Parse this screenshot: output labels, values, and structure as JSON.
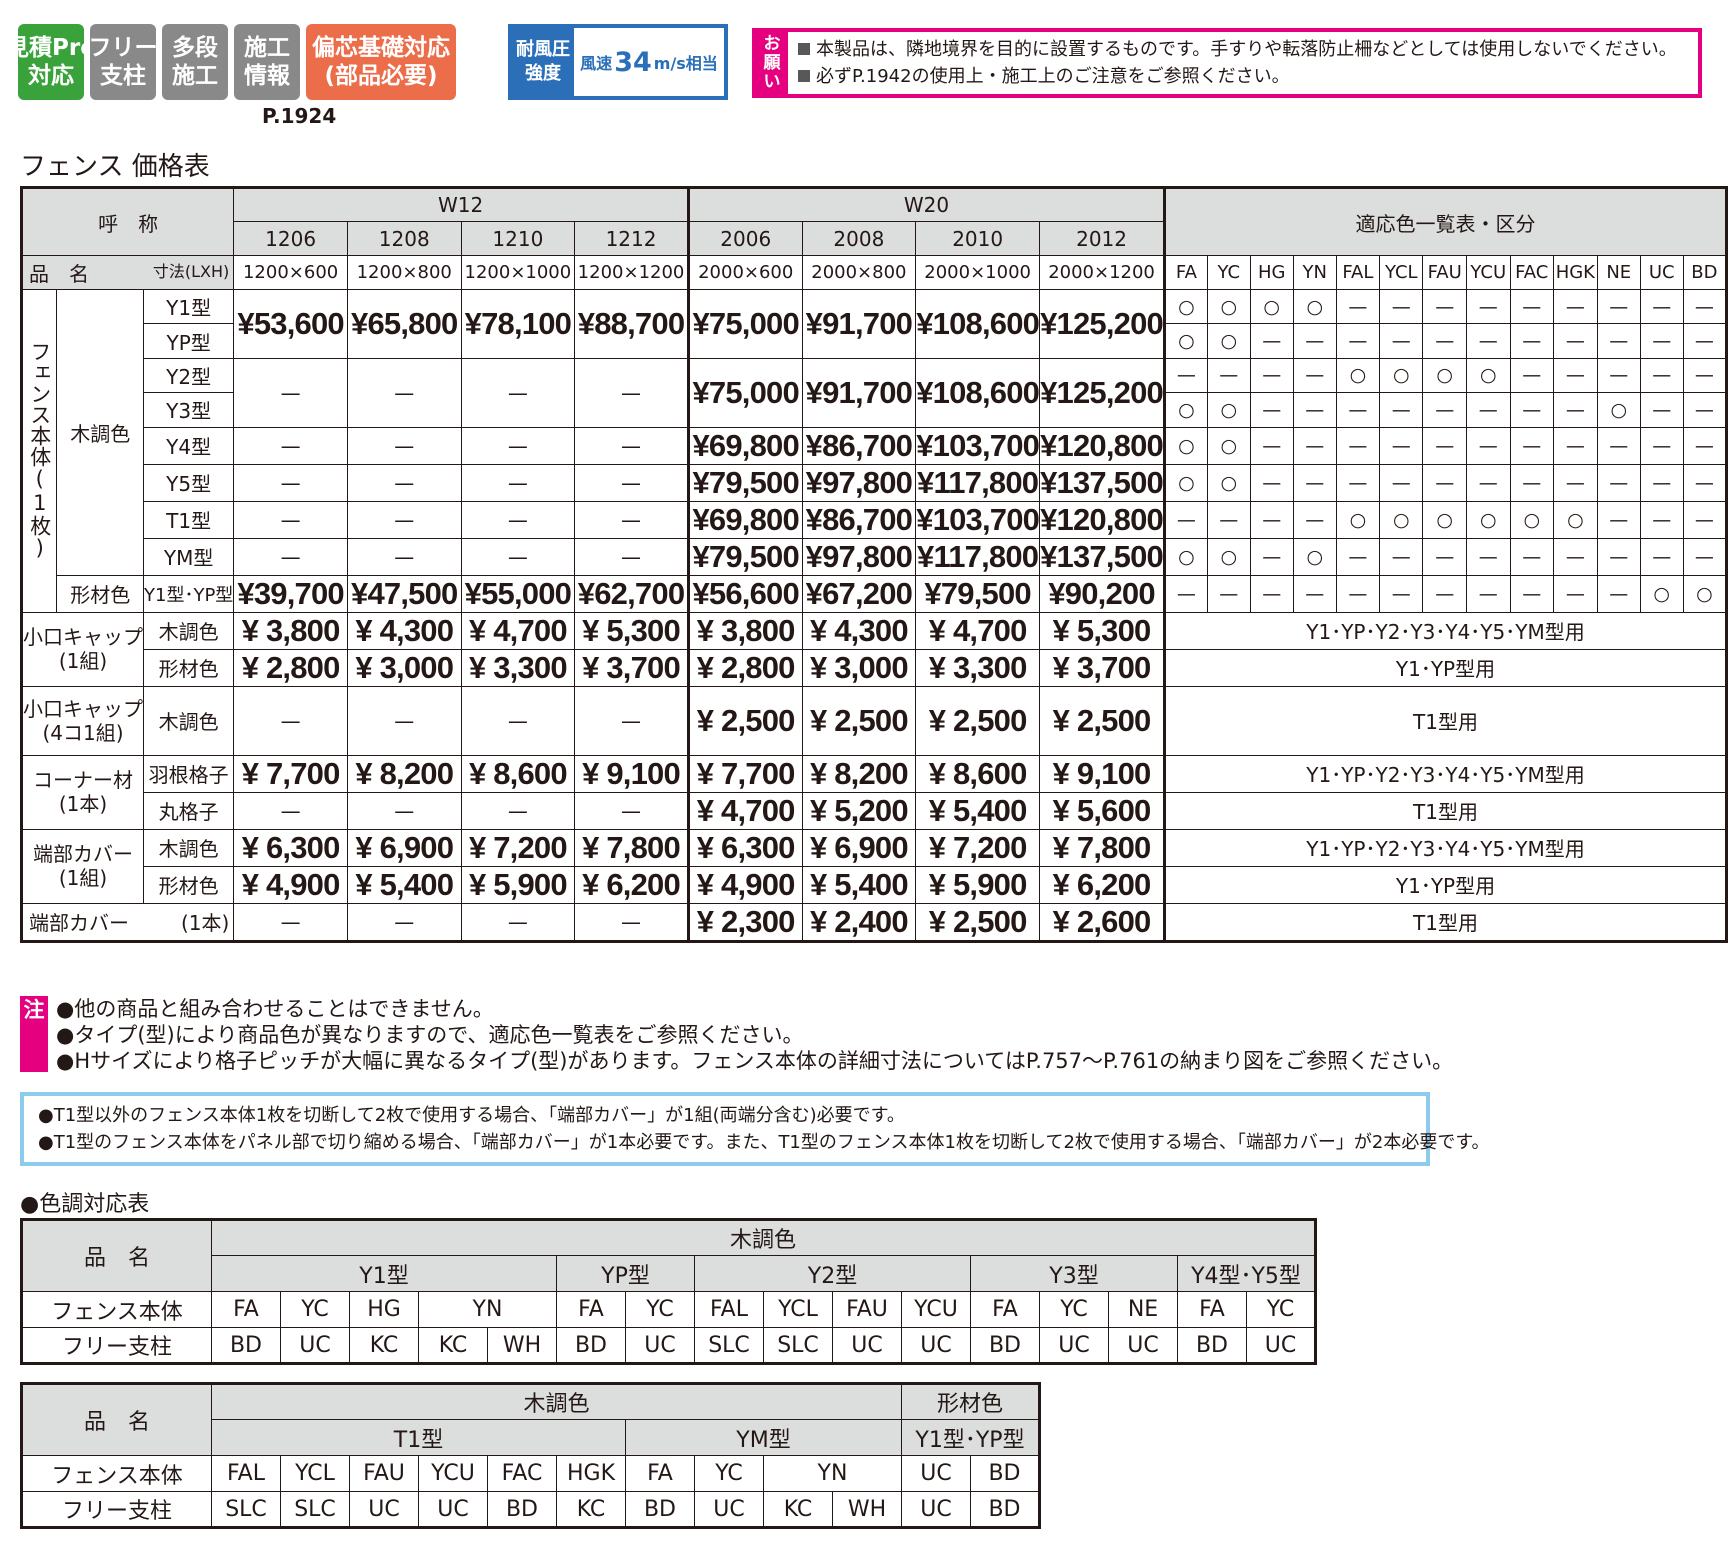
{
  "badges": [
    {
      "l1": "見積Pro",
      "l2": "対応",
      "color": "#3aa23a"
    },
    {
      "l1": "フリー",
      "l2": "支柱",
      "color": "#898989"
    },
    {
      "l1": "多段",
      "l2": "施工",
      "color": "#898989"
    },
    {
      "l1": "施工",
      "l2": "情報",
      "color": "#898989"
    },
    {
      "l1": "偏芯基礎対応",
      "l2": "(部品必要)",
      "color": "#ec6d4a"
    }
  ],
  "badge_page": "P.1924",
  "wind": {
    "l1": "耐風圧",
    "l2": "強度",
    "pre": "風速",
    "num": "34",
    "post": "m/s相当"
  },
  "request": {
    "tag": [
      "お",
      "願",
      "い"
    ],
    "lines": [
      "本製品は、隣地境界を目的に設置するものです。手すりや転落防止柵などとしては使用しないでください。",
      "必ずP.1942の使用上・施工上のご注意をご参照ください。"
    ]
  },
  "section_title": "フェンス 価格表",
  "table": {
    "name_h": "呼　称",
    "item_h": "品　名",
    "dim_h": "寸法(LXH)",
    "w12": "W12",
    "w20": "W20",
    "color_h": "適応色一覧表・区分",
    "codes": [
      "1206",
      "1208",
      "1210",
      "1212",
      "2006",
      "2008",
      "2010",
      "2012"
    ],
    "dims": [
      "1200×600",
      "1200×800",
      "1200×1000",
      "1200×1200",
      "2000×600",
      "2000×800",
      "2000×1000",
      "2000×1200"
    ],
    "colors": [
      "FA",
      "YC",
      "HG",
      "YN",
      "FAL",
      "YCL",
      "FAU",
      "YCU",
      "FAC",
      "HGK",
      "NE",
      "UC",
      "BD"
    ],
    "body_label": "フェンス本体(1枚)",
    "wood": "木調色",
    "shape": "形材色",
    "types": [
      "Y1型",
      "YP型",
      "Y2型",
      "Y3型",
      "Y4型",
      "Y5型",
      "T1型",
      "YM型",
      "Y1型･YP型"
    ],
    "dash": "—",
    "circle": "○",
    "y1yp_prices": [
      "¥53,600",
      "¥65,800",
      "¥78,100",
      "¥88,700",
      "¥75,000",
      "¥91,700",
      "¥108,600",
      "¥125,200"
    ],
    "y2y3_prices": [
      "¥75,000",
      "¥91,700",
      "¥108,600",
      "¥125,200"
    ],
    "y4_prices": [
      "¥69,800",
      "¥86,700",
      "¥103,700",
      "¥120,800"
    ],
    "y5_prices": [
      "¥79,500",
      "¥97,800",
      "¥117,800",
      "¥137,500"
    ],
    "t1_prices": [
      "¥69,800",
      "¥86,700",
      "¥103,700",
      "¥120,800"
    ],
    "ym_prices": [
      "¥79,500",
      "¥97,800",
      "¥117,800",
      "¥137,500"
    ],
    "shape_prices": [
      "¥39,700",
      "¥47,500",
      "¥55,000",
      "¥62,700",
      "¥56,600",
      "¥67,200",
      "¥79,500",
      "¥90,200"
    ],
    "color_marks": [
      [
        "○",
        "○",
        "○",
        "○",
        "—",
        "—",
        "—",
        "—",
        "—",
        "—",
        "—",
        "—",
        "—"
      ],
      [
        "○",
        "○",
        "—",
        "—",
        "—",
        "—",
        "—",
        "—",
        "—",
        "—",
        "—",
        "—",
        "—"
      ],
      [
        "—",
        "—",
        "—",
        "—",
        "○",
        "○",
        "○",
        "○",
        "—",
        "—",
        "—",
        "—",
        "—"
      ],
      [
        "○",
        "○",
        "—",
        "—",
        "—",
        "—",
        "—",
        "—",
        "—",
        "—",
        "○",
        "—",
        "—"
      ],
      [
        "○",
        "○",
        "—",
        "—",
        "—",
        "—",
        "—",
        "—",
        "—",
        "—",
        "—",
        "—",
        "—"
      ],
      [
        "○",
        "○",
        "—",
        "—",
        "—",
        "—",
        "—",
        "—",
        "—",
        "—",
        "—",
        "—",
        "—"
      ],
      [
        "—",
        "—",
        "—",
        "—",
        "○",
        "○",
        "○",
        "○",
        "○",
        "○",
        "—",
        "—",
        "—"
      ],
      [
        "○",
        "○",
        "—",
        "○",
        "—",
        "—",
        "—",
        "—",
        "—",
        "—",
        "—",
        "—",
        "—"
      ],
      [
        "—",
        "—",
        "—",
        "—",
        "—",
        "—",
        "—",
        "—",
        "—",
        "—",
        "—",
        "○",
        "○"
      ]
    ],
    "cap1": {
      "l1": "小口キャップ",
      "l2": "(1組)"
    },
    "cap4": {
      "l1": "小口キャップ",
      "l2": "(4コ1組)"
    },
    "corner": {
      "l1": "コーナー材",
      "l2": "(1本)"
    },
    "endc": {
      "l1": "端部カバー",
      "l2": "(1組)"
    },
    "end1": {
      "l1": "端部カバー",
      "l2": "(1本)"
    },
    "hane": "羽根格子",
    "maru": "丸格子",
    "cap1_wood": [
      "¥ 3,800",
      "¥ 4,300",
      "¥ 4,700",
      "¥ 5,300",
      "¥ 3,800",
      "¥ 4,300",
      "¥ 4,700",
      "¥ 5,300"
    ],
    "cap1_shape": [
      "¥ 2,800",
      "¥ 3,000",
      "¥ 3,300",
      "¥ 3,700",
      "¥ 2,800",
      "¥ 3,000",
      "¥ 3,300",
      "¥ 3,700"
    ],
    "cap4_wood": [
      "¥ 2,500",
      "¥ 2,500",
      "¥ 2,500",
      "¥ 2,500"
    ],
    "corner_hane": [
      "¥ 7,700",
      "¥ 8,200",
      "¥ 8,600",
      "¥ 9,100",
      "¥ 7,700",
      "¥ 8,200",
      "¥ 8,600",
      "¥ 9,100"
    ],
    "corner_maru": [
      "¥ 4,700",
      "¥ 5,200",
      "¥ 5,400",
      "¥ 5,600"
    ],
    "endc_wood": [
      "¥ 6,300",
      "¥ 6,900",
      "¥ 7,200",
      "¥ 7,800",
      "¥ 6,300",
      "¥ 6,900",
      "¥ 7,200",
      "¥ 7,800"
    ],
    "endc_shape": [
      "¥ 4,900",
      "¥ 5,400",
      "¥ 5,900",
      "¥ 6,200",
      "¥ 4,900",
      "¥ 5,400",
      "¥ 5,900",
      "¥ 6,200"
    ],
    "end1_prices": [
      "¥ 2,300",
      "¥ 2,400",
      "¥ 2,500",
      "¥ 2,600"
    ],
    "use_all": "Y1･YP･Y2･Y3･Y4･Y5･YM型用",
    "use_y1yp": "Y1･YP型用",
    "use_t1": "T1型用"
  },
  "notes": {
    "tag": "注",
    "lines": [
      "●他の商品と組み合わせることはできません。",
      "●タイプ(型)により商品色が異なりますので、適応色一覧表をご参照ください。",
      "●Hサイズにより格子ピッチが大幅に異なるタイプ(型)があります。フェンス本体の詳細寸法についてはP.757〜P.761の納まり図をご参照ください。"
    ]
  },
  "info": [
    "●T1型以外のフェンス本体1枚を切断して2枚で使用する場合、「端部カバー」が1組(両端分含む)必要です。",
    "●T1型のフェンス本体をパネル部で切り縮める場合、「端部カバー」が1本必要です。また、T1型のフェンス本体1枚を切断して2枚で使用する場合、「端部カバー」が2本必要です。"
  ],
  "color_section": "●色調対応表",
  "ct": {
    "item": "品　名",
    "wood": "木調色",
    "shape": "形材色",
    "body": "フェンス本体",
    "post": "フリー支柱",
    "t1_types": [
      "Y1型",
      "YP型",
      "Y2型",
      "Y3型",
      "Y4型･Y5型"
    ],
    "t1_body": [
      "FA",
      "YC",
      "HG",
      "YN",
      "FA",
      "YC",
      "FAL",
      "YCL",
      "FAU",
      "YCU",
      "FA",
      "YC",
      "NE",
      "FA",
      "YC"
    ],
    "t1_post": [
      "BD",
      "UC",
      "KC",
      "KC",
      "WH",
      "BD",
      "UC",
      "SLC",
      "SLC",
      "UC",
      "UC",
      "BD",
      "UC",
      "UC",
      "BD",
      "UC"
    ],
    "t2_types": [
      "T1型",
      "YM型",
      "Y1型･YP型"
    ],
    "t2_body": [
      "FAL",
      "YCL",
      "FAU",
      "YCU",
      "FAC",
      "HGK",
      "FA",
      "YC",
      "YN",
      "UC",
      "BD"
    ],
    "t2_post": [
      "SLC",
      "SLC",
      "UC",
      "UC",
      "BD",
      "KC",
      "BD",
      "UC",
      "KC",
      "WH",
      "UC",
      "BD"
    ]
  }
}
